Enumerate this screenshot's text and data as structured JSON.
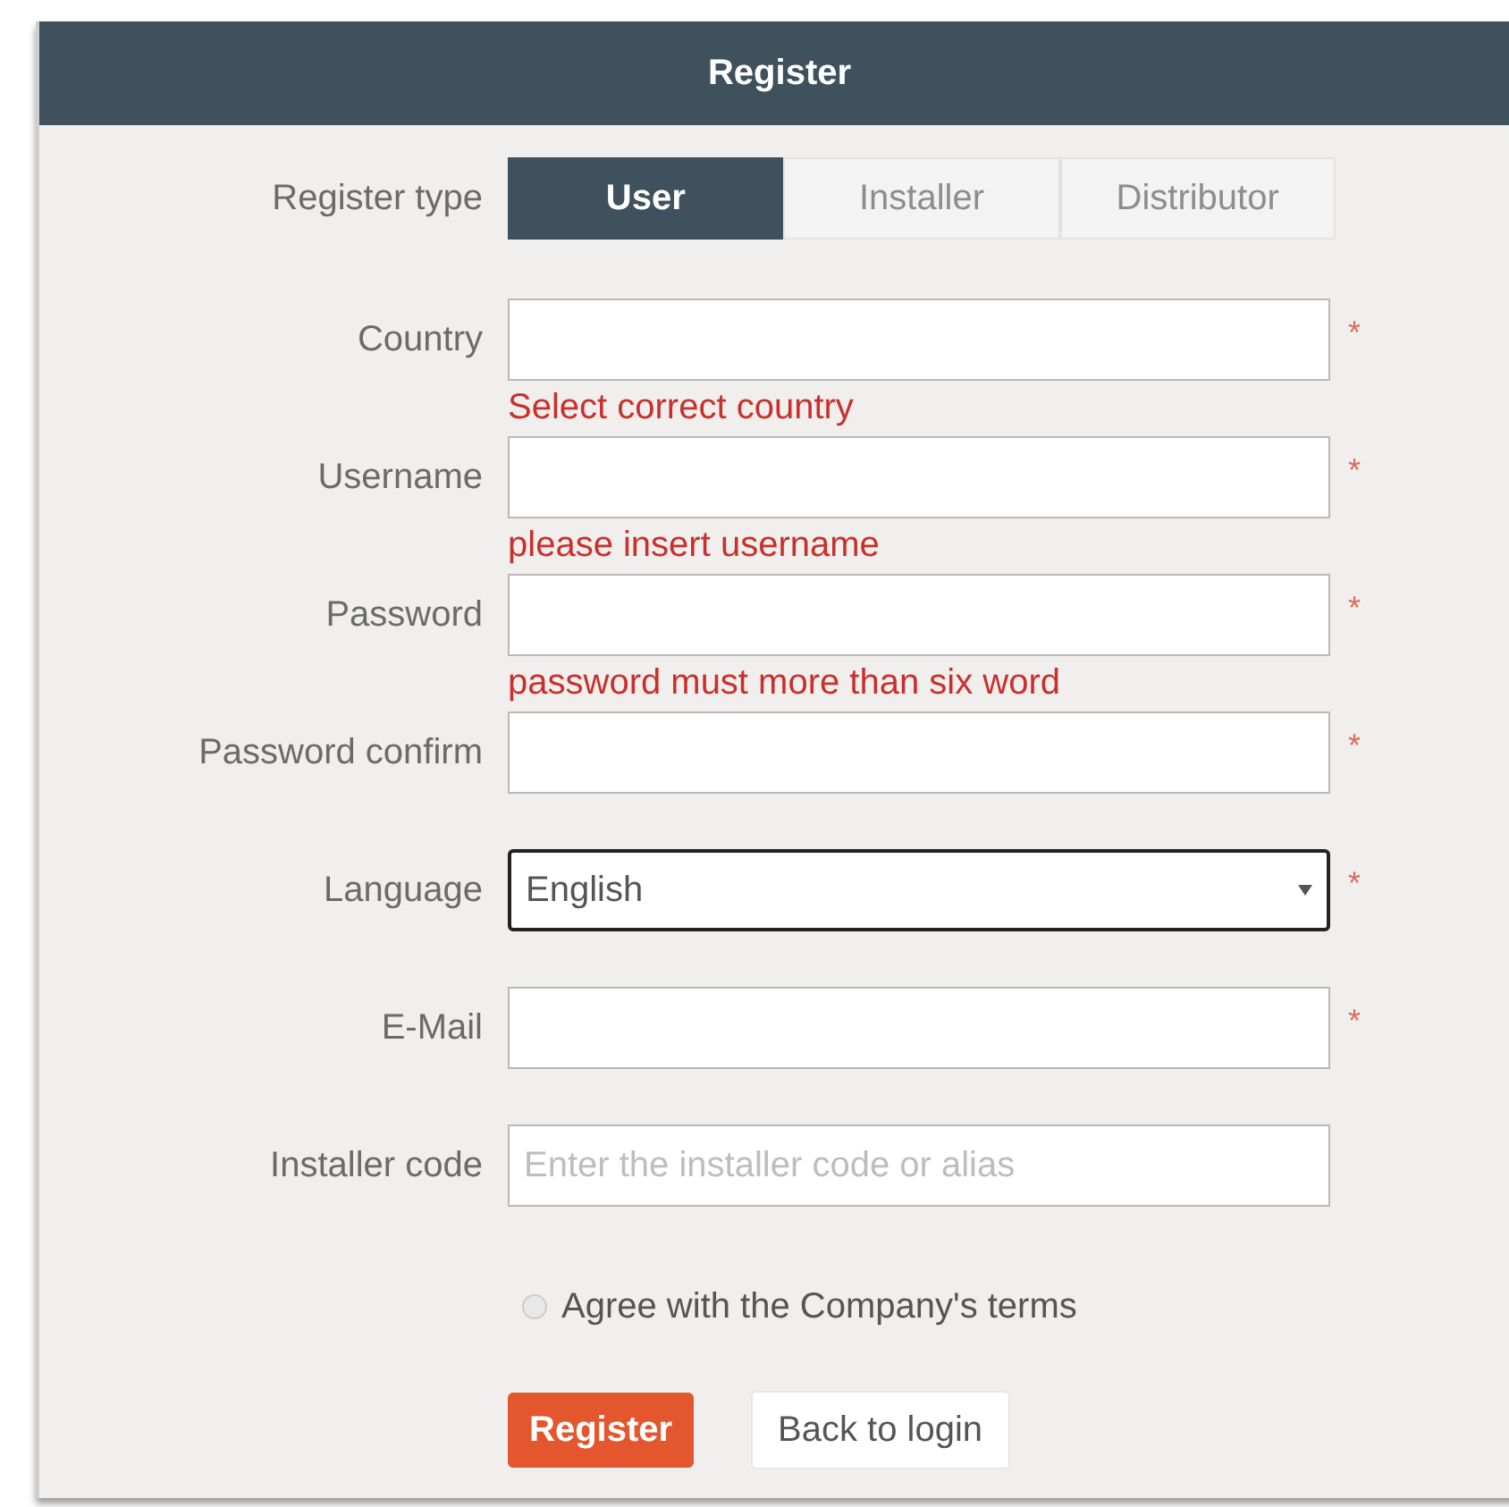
{
  "dialog": {
    "title": "Register"
  },
  "register_type": {
    "label": "Register type",
    "tabs": [
      {
        "label": "User",
        "selected": true
      },
      {
        "label": "Installer",
        "selected": false
      },
      {
        "label": "Distributor",
        "selected": false
      }
    ]
  },
  "fields": [
    {
      "kind": "text",
      "label": "Country",
      "required_mark": "*",
      "error": "Select correct country"
    },
    {
      "kind": "text",
      "label": "Username",
      "required_mark": "*",
      "error": "please insert username"
    },
    {
      "kind": "text",
      "label": "Password",
      "required_mark": "*",
      "error": "password must more than six word"
    },
    {
      "kind": "text",
      "label": "Password confirm",
      "required_mark": "*"
    },
    {
      "kind": "select",
      "label": "Language",
      "value": "English",
      "required_mark": "*",
      "focused": true
    },
    {
      "kind": "text",
      "label": "E-Mail",
      "required_mark": "*"
    },
    {
      "kind": "text",
      "label": "Installer code",
      "placeholder": "Enter the installer code or alias"
    }
  ],
  "terms": {
    "label": "Agree with the Company's terms",
    "checked": false
  },
  "buttons": [
    {
      "kind": "primary",
      "label": "Register"
    },
    {
      "kind": "secondary",
      "label": "Back to login"
    }
  ]
}
